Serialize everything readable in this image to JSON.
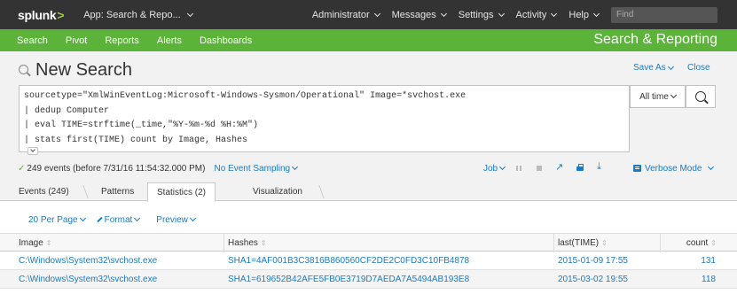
{
  "topbar": {
    "logo_text": "splunk",
    "logo_suffix": ">",
    "app_menu": "App: Search & Repo...",
    "items": [
      "Administrator",
      "Messages",
      "Settings",
      "Activity",
      "Help"
    ],
    "find_placeholder": "Find"
  },
  "appbar": {
    "nav": [
      "Search",
      "Pivot",
      "Reports",
      "Alerts",
      "Dashboards"
    ],
    "app_title": "Search & Reporting",
    "color": "#5cb33a"
  },
  "search": {
    "title": "New Search",
    "save_as": "Save As",
    "close": "Close",
    "query_lines": [
      "sourcetype=\"XmlWinEventLog:Microsoft-Windows-Sysmon/Operational\" Image=*svchost.exe",
      "| dedup Computer",
      "| eval TIME=strftime(_time,\"%Y-%m-%d %H:%M\")",
      "| stats first(TIME) count by Image, Hashes"
    ],
    "time_range": "All time"
  },
  "status": {
    "check": "✓",
    "events": "249 events (before 7/31/16 11:54:32.000 PM)",
    "sampling": "No Event Sampling",
    "job": "Job",
    "mode": "Verbose Mode"
  },
  "tabs": [
    "Events (249)",
    "Patterns",
    "Statistics (2)",
    "Visualization"
  ],
  "toolbar": {
    "per_page": "20 Per Page",
    "format": "Format",
    "preview": "Preview"
  },
  "table": {
    "columns": [
      "Image",
      "Hashes",
      "last(TIME)",
      "count"
    ],
    "sort_glyph": "⇕",
    "rows": [
      [
        "C:\\Windows\\System32\\svchost.exe",
        "SHA1=4AF001B3C3816B860560CF2DE2C0FD3C10FB4878",
        "2015-01-09 17:55",
        "131"
      ],
      [
        "C:\\Windows\\System32\\svchost.exe",
        "SHA1=619652B42AFE5FB0E3719D7AEDA7A5494AB193E8",
        "2015-03-02 19:55",
        "118"
      ]
    ]
  },
  "colors": {
    "topbar": "#333333",
    "link": "#1a7ac4",
    "accent": "#5cb33a"
  }
}
